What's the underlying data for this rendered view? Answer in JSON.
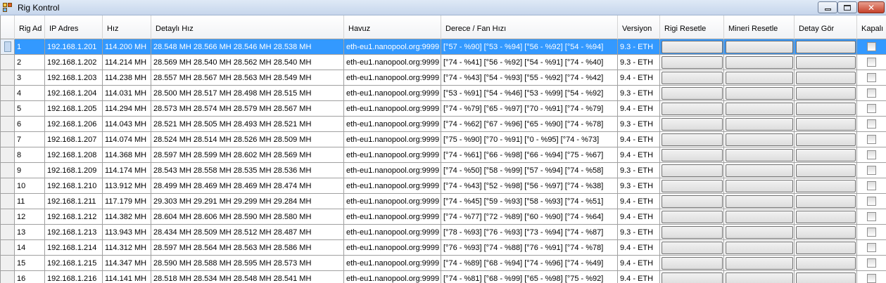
{
  "window": {
    "title": "Rig Kontrol",
    "icon": "app-icon"
  },
  "columns": [
    "Rig Ad",
    "IP Adres",
    "Hız",
    "Detaylı Hız",
    "Havuz",
    "Derece / Fan Hızı",
    "Versiyon",
    "Rigi Resetle",
    "Mineri Resetle",
    "Detay Gör",
    "Kapalı"
  ],
  "rows": [
    {
      "ad": "1",
      "ip": "192.168.1.201",
      "hiz": "114.200 MH",
      "detay": "28.548 MH 28.566 MH 28.546 MH 28.538 MH",
      "havuz": "eth-eu1.nanopool.org:9999",
      "derece": "[°57 - %90]  [°53 - %94]  [°56 - %92]  [°54 - %94]",
      "versiyon": "9.3 - ETH",
      "selected": true
    },
    {
      "ad": "2",
      "ip": "192.168.1.202",
      "hiz": "114.214 MH",
      "detay": "28.569 MH 28.540 MH 28.562 MH 28.540 MH",
      "havuz": "eth-eu1.nanopool.org:9999",
      "derece": "[°74 - %41]  [°56 - %92]  [°54 - %91]  [°74 - %40]",
      "versiyon": "9.3 - ETH",
      "selected": false
    },
    {
      "ad": "3",
      "ip": "192.168.1.203",
      "hiz": "114.238 MH",
      "detay": "28.557 MH 28.567 MH 28.563 MH 28.549 MH",
      "havuz": "eth-eu1.nanopool.org:9999",
      "derece": "[°74 - %43]  [°54 - %93]  [°55 - %92]  [°74 - %42]",
      "versiyon": "9.4 - ETH",
      "selected": false
    },
    {
      "ad": "4",
      "ip": "192.168.1.204",
      "hiz": "114.031 MH",
      "detay": "28.500 MH 28.517 MH 28.498 MH 28.515 MH",
      "havuz": "eth-eu1.nanopool.org:9999",
      "derece": "[°53 - %91]  [°54 - %46]  [°53 - %99]  [°54 - %92]",
      "versiyon": "9.3 - ETH",
      "selected": false
    },
    {
      "ad": "5",
      "ip": "192.168.1.205",
      "hiz": "114.294 MH",
      "detay": "28.573 MH 28.574 MH 28.579 MH 28.567 MH",
      "havuz": "eth-eu1.nanopool.org:9999",
      "derece": "[°74 - %79]  [°65 - %97]  [°70 - %91]  [°74 - %79]",
      "versiyon": "9.4 - ETH",
      "selected": false
    },
    {
      "ad": "6",
      "ip": "192.168.1.206",
      "hiz": "114.043 MH",
      "detay": "28.521 MH 28.505 MH 28.493 MH 28.521 MH",
      "havuz": "eth-eu1.nanopool.org:9999",
      "derece": "[°74 - %62]  [°67 - %96]  [°65 - %90]  [°74 - %78]",
      "versiyon": "9.3 - ETH",
      "selected": false
    },
    {
      "ad": "7",
      "ip": "192.168.1.207",
      "hiz": "114.074 MH",
      "detay": "28.524 MH 28.514 MH 28.526 MH 28.509 MH",
      "havuz": "eth-eu1.nanopool.org:9999",
      "derece": "[°75 - %90]  [°70 - %91]  [°0 - %95]  [°74 - %73]",
      "versiyon": "9.4 - ETH",
      "selected": false
    },
    {
      "ad": "8",
      "ip": "192.168.1.208",
      "hiz": "114.368 MH",
      "detay": "28.597 MH 28.599 MH 28.602 MH 28.569 MH",
      "havuz": "eth-eu1.nanopool.org:9999",
      "derece": "[°74 - %61]  [°66 - %98]  [°66 - %94]  [°75 - %67]",
      "versiyon": "9.4 - ETH",
      "selected": false
    },
    {
      "ad": "9",
      "ip": "192.168.1.209",
      "hiz": "114.174 MH",
      "detay": "28.543 MH 28.558 MH 28.535 MH 28.536 MH",
      "havuz": "eth-eu1.nanopool.org:9999",
      "derece": "[°74 - %50]  [°58 - %99]  [°57 - %94]  [°74 - %58]",
      "versiyon": "9.3 - ETH",
      "selected": false
    },
    {
      "ad": "10",
      "ip": "192.168.1.210",
      "hiz": "113.912 MH",
      "detay": "28.499 MH 28.469 MH 28.469 MH 28.474 MH",
      "havuz": "eth-eu1.nanopool.org:9999",
      "derece": "[°74 - %43]  [°52 - %98]  [°56 - %97]  [°74 - %38]",
      "versiyon": "9.3 - ETH",
      "selected": false
    },
    {
      "ad": "11",
      "ip": "192.168.1.211",
      "hiz": "117.179 MH",
      "detay": "29.303 MH 29.291 MH 29.299 MH 29.284 MH",
      "havuz": "eth-eu1.nanopool.org:9999",
      "derece": "[°74 - %45]  [°59 - %93]  [°58 - %93]  [°74 - %51]",
      "versiyon": "9.4 - ETH",
      "selected": false
    },
    {
      "ad": "12",
      "ip": "192.168.1.212",
      "hiz": "114.382 MH",
      "detay": "28.604 MH 28.606 MH 28.590 MH 28.580 MH",
      "havuz": "eth-eu1.nanopool.org:9999",
      "derece": "[°74 - %77]  [°72 - %89]  [°60 - %90]  [°74 - %64]",
      "versiyon": "9.4 - ETH",
      "selected": false
    },
    {
      "ad": "13",
      "ip": "192.168.1.213",
      "hiz": "113.943 MH",
      "detay": "28.434 MH 28.509 MH 28.512 MH 28.487 MH",
      "havuz": "eth-eu1.nanopool.org:9999",
      "derece": "[°78 - %93]  [°76 - %93]  [°73 - %94]  [°74 - %87]",
      "versiyon": "9.3 - ETH",
      "selected": false
    },
    {
      "ad": "14",
      "ip": "192.168.1.214",
      "hiz": "114.312 MH",
      "detay": "28.597 MH 28.564 MH 28.563 MH 28.586 MH",
      "havuz": "eth-eu1.nanopool.org:9999",
      "derece": "[°76 - %93]  [°74 - %88]  [°76 - %91]  [°74 - %78]",
      "versiyon": "9.4 - ETH",
      "selected": false
    },
    {
      "ad": "15",
      "ip": "192.168.1.215",
      "hiz": "114.347 MH",
      "detay": "28.590 MH 28.588 MH 28.595 MH 28.573 MH",
      "havuz": "eth-eu1.nanopool.org:9999",
      "derece": "[°74 - %89]  [°68 - %94]  [°74 - %96]  [°74 - %49]",
      "versiyon": "9.4 - ETH",
      "selected": false
    },
    {
      "ad": "16",
      "ip": "192.168.1.216",
      "hiz": "114.141 MH",
      "detay": "28.518 MH 28.534 MH 28.548 MH 28.541 MH",
      "havuz": "eth-eu1.nanopool.org:9999",
      "derece": "[°74 - %81]  [°68 - %99]  [°65 - %98]  [°75 - %92]",
      "versiyon": "9.4 - ETH",
      "selected": false
    }
  ],
  "colors": {
    "selection": "#3399ff",
    "grid_line": "#a0a0a0"
  }
}
